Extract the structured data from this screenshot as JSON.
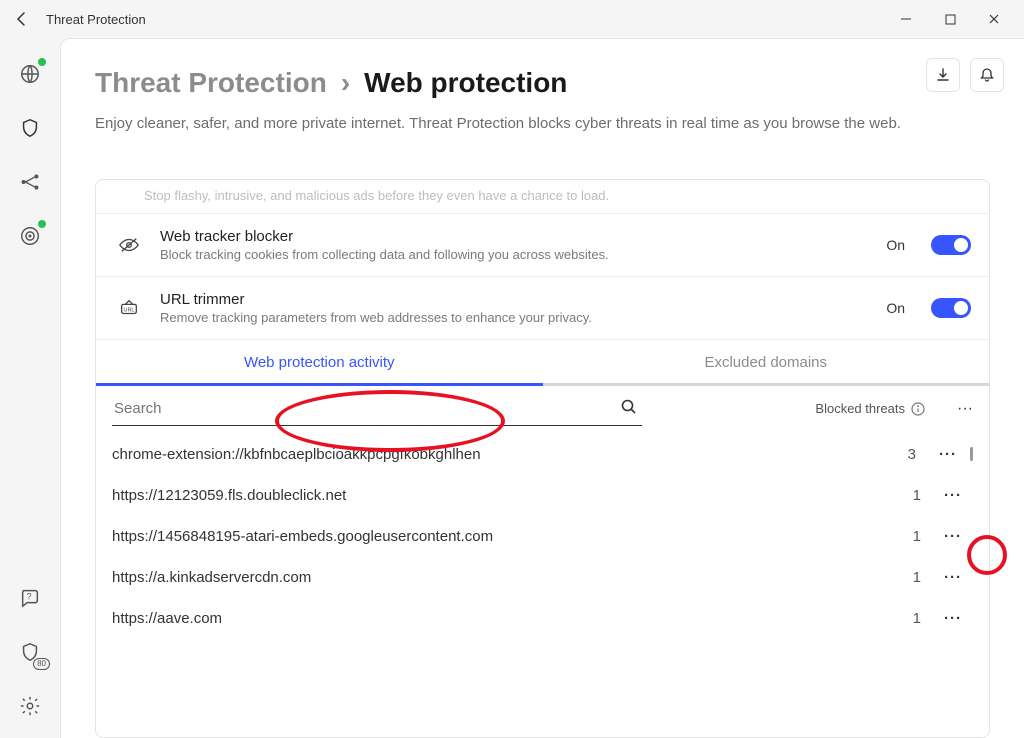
{
  "window": {
    "title": "Threat Protection"
  },
  "breadcrumb": {
    "root": "Threat Protection",
    "sep": "›",
    "current": "Web protection"
  },
  "subtitle": "Enjoy cleaner, safer, and more private internet. Threat Protection blocks cyber threats in real time as you browse the web.",
  "faded_partial": "Stop flashy, intrusive, and malicious ads before they even have a chance to load.",
  "settings": [
    {
      "title": "Web tracker blocker",
      "desc": "Block tracking cookies from collecting data and following you across websites.",
      "state": "On"
    },
    {
      "title": "URL trimmer",
      "desc": "Remove tracking parameters from web addresses to enhance your privacy.",
      "state": "On"
    }
  ],
  "tabs": {
    "activity": "Web protection activity",
    "excluded": "Excluded domains"
  },
  "search": {
    "placeholder": "Search"
  },
  "table": {
    "blocked_label": "Blocked threats",
    "rows": [
      {
        "url": "chrome-extension://kbfnbcaeplbcioakkpcpgfkobkghlhen",
        "count": "3"
      },
      {
        "url": "https://12123059.fls.doubleclick.net",
        "count": "1"
      },
      {
        "url": "https://1456848195-atari-embeds.googleusercontent.com",
        "count": "1"
      },
      {
        "url": "https://a.kinkadservercdn.com",
        "count": "1"
      },
      {
        "url": "https://aave.com",
        "count": "1"
      }
    ]
  },
  "sidebar": {
    "shield_badge": "80"
  }
}
